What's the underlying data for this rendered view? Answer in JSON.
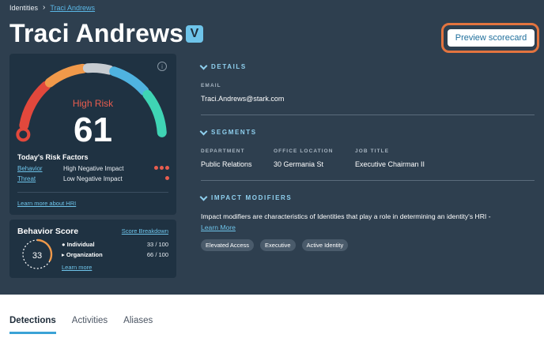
{
  "breadcrumb": {
    "root": "Identities",
    "separator": "›",
    "current": "Traci Andrews"
  },
  "header": {
    "name": "Traci Andrews",
    "badge": "V",
    "preview_button": "Preview scorecard"
  },
  "risk_card": {
    "level": "High Risk",
    "score": "61",
    "factors_title": "Today's Risk Factors",
    "factors": [
      {
        "name": "Behavior",
        "impact": "High Negative Impact",
        "dots": 3
      },
      {
        "name": "Threat",
        "impact": "Low Negative Impact",
        "dots": 1
      }
    ],
    "learn_more": "Learn more about HRI",
    "gauge_colors": [
      "#e2483c",
      "#f0994a",
      "#c7ccd1",
      "#4fb3e0",
      "#3fd4b4"
    ]
  },
  "behavior_card": {
    "title": "Behavior Score",
    "breakdown_link": "Score Breakdown",
    "score": "33",
    "score_fraction": 0.33,
    "rows": [
      {
        "marker": "●",
        "label": "Individual",
        "value": "33 / 100"
      },
      {
        "marker": "▸",
        "label": "Organization",
        "value": "66 / 100"
      }
    ],
    "learn_more": "Learn more"
  },
  "details": {
    "heading": "DETAILS",
    "email_label": "EMAIL",
    "email": "Traci.Andrews@stark.com"
  },
  "segments": {
    "heading": "SEGMENTS",
    "department_label": "DEPARTMENT",
    "department": "Public Relations",
    "office_label": "OFFICE LOCATION",
    "office": "30 Germania St",
    "job_label": "JOB TITLE",
    "job": "Executive Chairman II"
  },
  "impact_modifiers": {
    "heading": "IMPACT MODIFIERS",
    "description": "Impact modifiers are characteristics of Identities that play a role in determining an identity's HRI - ",
    "learn_more": "Learn More",
    "tags": [
      "Elevated Access",
      "Executive",
      "Active Identity"
    ]
  },
  "tabs": [
    "Detections",
    "Activities",
    "Aliases"
  ],
  "colors": {
    "accent": "#3aa3d6",
    "risk_red": "#e85d4f",
    "hero_bg": "#2e3f4f",
    "card_bg": "#1f3242",
    "highlight": "#e3743f"
  }
}
